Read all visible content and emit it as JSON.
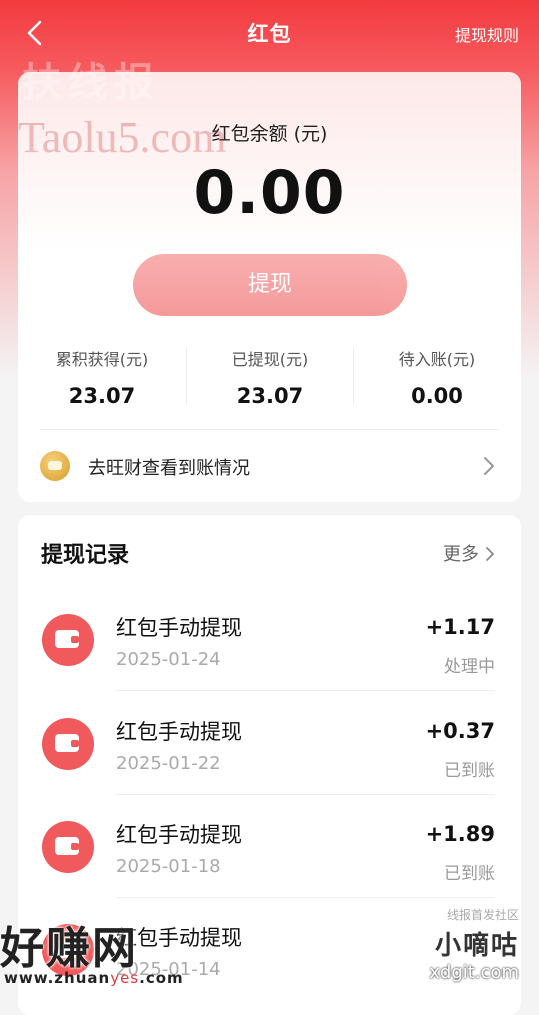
{
  "nav": {
    "title": "红包",
    "rule_link": "提现规则"
  },
  "watermarks": {
    "top_cn": "扶线报",
    "top_en": "Taolu5.com",
    "bottom_left": "好赚网",
    "bottom_left_url_a": "www.zhuan",
    "bottom_left_url_b": "yes",
    "bottom_left_url_c": ".com",
    "bottom_right_small": "线报首发社区",
    "bottom_right_big": "小嘀咕",
    "bottom_right_url": "xdgit.com"
  },
  "balance": {
    "label": "红包余额 (元)",
    "amount": "0.00",
    "withdraw_button": "提现"
  },
  "stats": [
    {
      "label": "累积获得(元)",
      "value": "23.07"
    },
    {
      "label": "已提现(元)",
      "value": "23.07"
    },
    {
      "label": "待入账(元)",
      "value": "0.00"
    }
  ],
  "wangcai": {
    "text": "去旺财查看到账情况"
  },
  "records": {
    "title": "提现记录",
    "more": "更多",
    "items": [
      {
        "name": "红包手动提现",
        "date": "2025-01-24",
        "amount": "+1.17",
        "status": "处理中"
      },
      {
        "name": "红包手动提现",
        "date": "2025-01-22",
        "amount": "+0.37",
        "status": "已到账"
      },
      {
        "name": "红包手动提现",
        "date": "2025-01-18",
        "amount": "+1.89",
        "status": "已到账"
      },
      {
        "name": "红包手动提现",
        "date": "2025-01-14",
        "amount": "",
        "status": ""
      }
    ]
  }
}
